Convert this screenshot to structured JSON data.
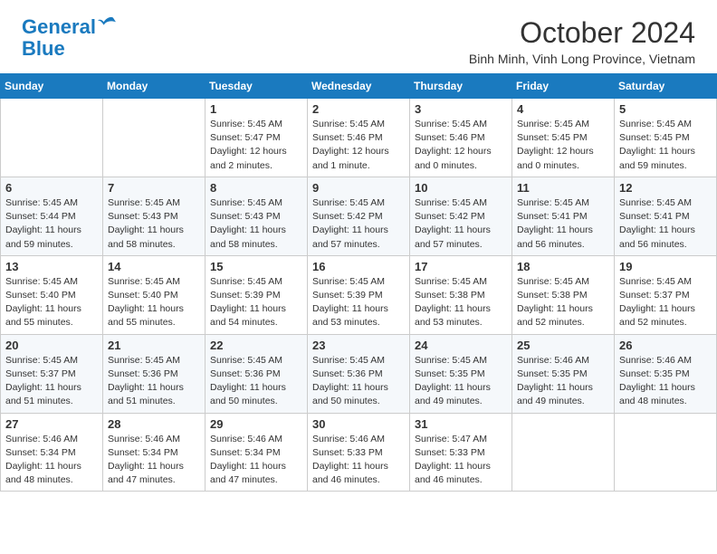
{
  "header": {
    "logo_line1": "General",
    "logo_line2": "Blue",
    "month_title": "October 2024",
    "location": "Binh Minh, Vinh Long Province, Vietnam"
  },
  "days_of_week": [
    "Sunday",
    "Monday",
    "Tuesday",
    "Wednesday",
    "Thursday",
    "Friday",
    "Saturday"
  ],
  "weeks": [
    [
      {
        "day": "",
        "info": ""
      },
      {
        "day": "",
        "info": ""
      },
      {
        "day": "1",
        "info": "Sunrise: 5:45 AM\nSunset: 5:47 PM\nDaylight: 12 hours\nand 2 minutes."
      },
      {
        "day": "2",
        "info": "Sunrise: 5:45 AM\nSunset: 5:46 PM\nDaylight: 12 hours\nand 1 minute."
      },
      {
        "day": "3",
        "info": "Sunrise: 5:45 AM\nSunset: 5:46 PM\nDaylight: 12 hours\nand 0 minutes."
      },
      {
        "day": "4",
        "info": "Sunrise: 5:45 AM\nSunset: 5:45 PM\nDaylight: 12 hours\nand 0 minutes."
      },
      {
        "day": "5",
        "info": "Sunrise: 5:45 AM\nSunset: 5:45 PM\nDaylight: 11 hours\nand 59 minutes."
      }
    ],
    [
      {
        "day": "6",
        "info": "Sunrise: 5:45 AM\nSunset: 5:44 PM\nDaylight: 11 hours\nand 59 minutes."
      },
      {
        "day": "7",
        "info": "Sunrise: 5:45 AM\nSunset: 5:43 PM\nDaylight: 11 hours\nand 58 minutes."
      },
      {
        "day": "8",
        "info": "Sunrise: 5:45 AM\nSunset: 5:43 PM\nDaylight: 11 hours\nand 58 minutes."
      },
      {
        "day": "9",
        "info": "Sunrise: 5:45 AM\nSunset: 5:42 PM\nDaylight: 11 hours\nand 57 minutes."
      },
      {
        "day": "10",
        "info": "Sunrise: 5:45 AM\nSunset: 5:42 PM\nDaylight: 11 hours\nand 57 minutes."
      },
      {
        "day": "11",
        "info": "Sunrise: 5:45 AM\nSunset: 5:41 PM\nDaylight: 11 hours\nand 56 minutes."
      },
      {
        "day": "12",
        "info": "Sunrise: 5:45 AM\nSunset: 5:41 PM\nDaylight: 11 hours\nand 56 minutes."
      }
    ],
    [
      {
        "day": "13",
        "info": "Sunrise: 5:45 AM\nSunset: 5:40 PM\nDaylight: 11 hours\nand 55 minutes."
      },
      {
        "day": "14",
        "info": "Sunrise: 5:45 AM\nSunset: 5:40 PM\nDaylight: 11 hours\nand 55 minutes."
      },
      {
        "day": "15",
        "info": "Sunrise: 5:45 AM\nSunset: 5:39 PM\nDaylight: 11 hours\nand 54 minutes."
      },
      {
        "day": "16",
        "info": "Sunrise: 5:45 AM\nSunset: 5:39 PM\nDaylight: 11 hours\nand 53 minutes."
      },
      {
        "day": "17",
        "info": "Sunrise: 5:45 AM\nSunset: 5:38 PM\nDaylight: 11 hours\nand 53 minutes."
      },
      {
        "day": "18",
        "info": "Sunrise: 5:45 AM\nSunset: 5:38 PM\nDaylight: 11 hours\nand 52 minutes."
      },
      {
        "day": "19",
        "info": "Sunrise: 5:45 AM\nSunset: 5:37 PM\nDaylight: 11 hours\nand 52 minutes."
      }
    ],
    [
      {
        "day": "20",
        "info": "Sunrise: 5:45 AM\nSunset: 5:37 PM\nDaylight: 11 hours\nand 51 minutes."
      },
      {
        "day": "21",
        "info": "Sunrise: 5:45 AM\nSunset: 5:36 PM\nDaylight: 11 hours\nand 51 minutes."
      },
      {
        "day": "22",
        "info": "Sunrise: 5:45 AM\nSunset: 5:36 PM\nDaylight: 11 hours\nand 50 minutes."
      },
      {
        "day": "23",
        "info": "Sunrise: 5:45 AM\nSunset: 5:36 PM\nDaylight: 11 hours\nand 50 minutes."
      },
      {
        "day": "24",
        "info": "Sunrise: 5:45 AM\nSunset: 5:35 PM\nDaylight: 11 hours\nand 49 minutes."
      },
      {
        "day": "25",
        "info": "Sunrise: 5:46 AM\nSunset: 5:35 PM\nDaylight: 11 hours\nand 49 minutes."
      },
      {
        "day": "26",
        "info": "Sunrise: 5:46 AM\nSunset: 5:35 PM\nDaylight: 11 hours\nand 48 minutes."
      }
    ],
    [
      {
        "day": "27",
        "info": "Sunrise: 5:46 AM\nSunset: 5:34 PM\nDaylight: 11 hours\nand 48 minutes."
      },
      {
        "day": "28",
        "info": "Sunrise: 5:46 AM\nSunset: 5:34 PM\nDaylight: 11 hours\nand 47 minutes."
      },
      {
        "day": "29",
        "info": "Sunrise: 5:46 AM\nSunset: 5:34 PM\nDaylight: 11 hours\nand 47 minutes."
      },
      {
        "day": "30",
        "info": "Sunrise: 5:46 AM\nSunset: 5:33 PM\nDaylight: 11 hours\nand 46 minutes."
      },
      {
        "day": "31",
        "info": "Sunrise: 5:47 AM\nSunset: 5:33 PM\nDaylight: 11 hours\nand 46 minutes."
      },
      {
        "day": "",
        "info": ""
      },
      {
        "day": "",
        "info": ""
      }
    ]
  ]
}
